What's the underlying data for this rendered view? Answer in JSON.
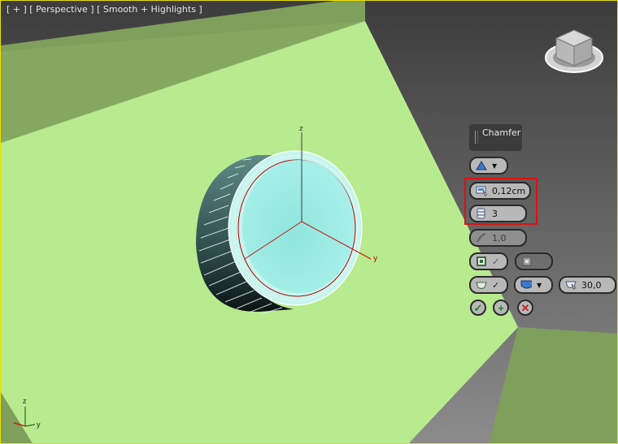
{
  "viewport": {
    "label_parts": [
      "[ + ]",
      "[ Perspective ]",
      "[ Smooth + Highlights ]"
    ]
  },
  "gizmo": {
    "axis_z": "z",
    "axis_y": "y"
  },
  "corner_axes": {
    "z": "z",
    "y": "y"
  },
  "caddy": {
    "title": "Chamfer",
    "amount": "0,12cm",
    "segments": "3",
    "tension": "1,0",
    "threshold": "30,0"
  }
}
